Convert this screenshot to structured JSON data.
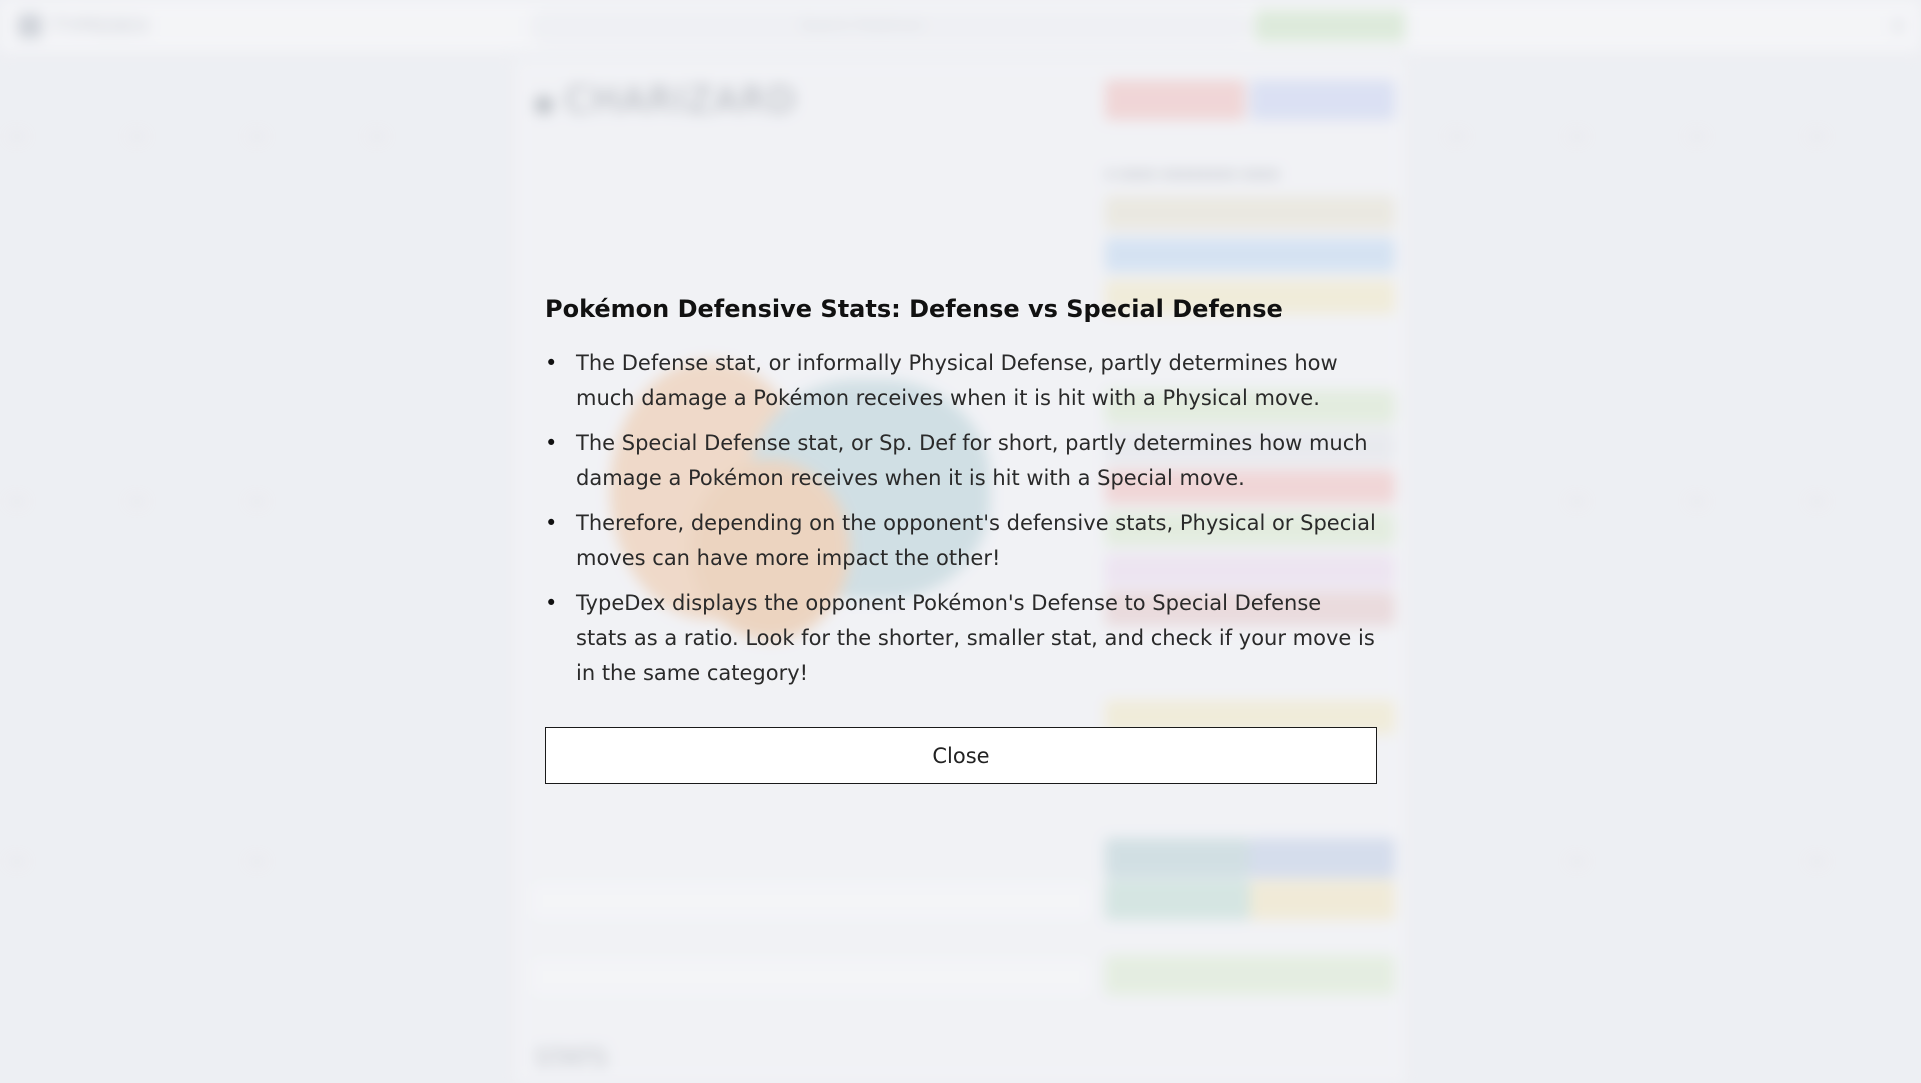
{
  "background": {
    "app_name": "TYPEDEX",
    "search_placeholder": "Search Pokémon",
    "pokemon_name": "CHARIZARD",
    "section_title": "STATS"
  },
  "modal": {
    "title": "Pokémon Defensive Stats: Defense vs Special Defense",
    "items": [
      "The Defense stat, or informally Physical Defense, partly determines how much damage a Pokémon receives when it is hit with a Physical move.",
      "The Special Defense stat, or Sp. Def for short, partly determines how much damage a Pokémon receives when it is hit with a Special move.",
      "Therefore, depending on the opponent's defensive stats, Physical or Special moves can have more impact the other!",
      "TypeDex displays the opponent Pokémon's Defense to Special Defense stats as a ratio. Look for the shorter, smaller stat, and check if your move is in the same category!"
    ],
    "close_label": "Close"
  },
  "colors": {
    "fire": "#f4a9a3",
    "flying": "#b9c7f2",
    "grass": "#cfe8bb",
    "ground": "#e4ddc0",
    "water": "#a9cdf0",
    "electric": "#f5e7ac",
    "poison": "#ecd2ee",
    "dragon": "#c8d9e6"
  }
}
